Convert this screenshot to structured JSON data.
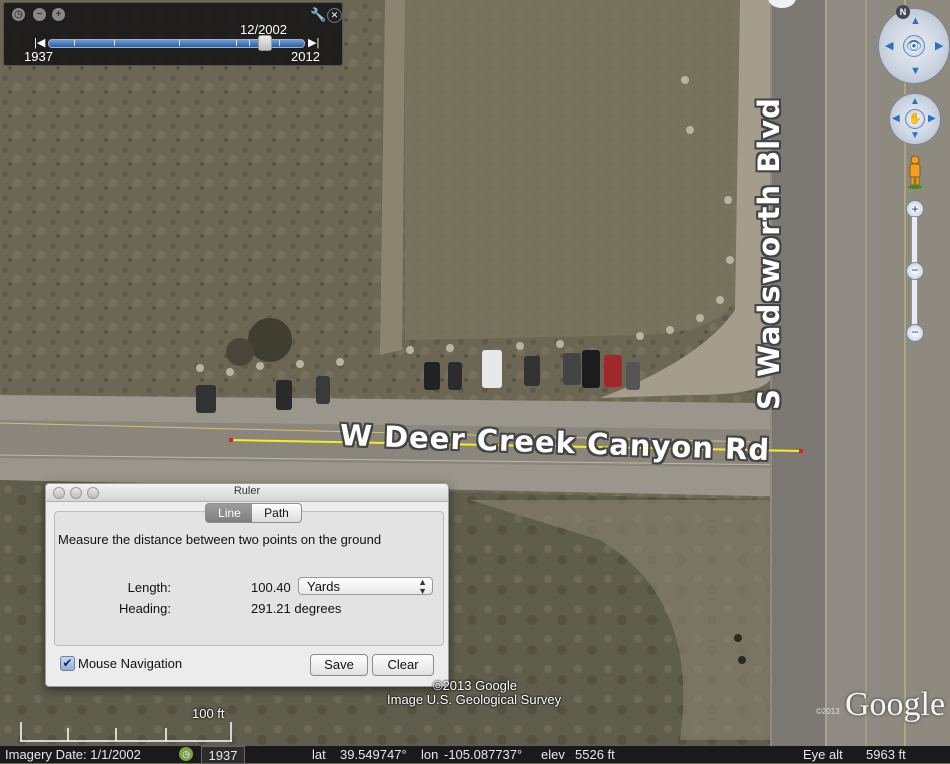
{
  "time_slider": {
    "current_date": "12/2002",
    "start_year": "1937",
    "end_year": "2012"
  },
  "map": {
    "road_label": "W Deer Creek Canyon Rd",
    "blvd_label": "S Wadsworth Blvd",
    "ruler_line_color": "#f5f019"
  },
  "ruler": {
    "title": "Ruler",
    "tabs": [
      {
        "label": "Line",
        "selected": true
      },
      {
        "label": "Path",
        "selected": false
      }
    ],
    "description": "Measure the distance between two points on the ground",
    "length_label": "Length:",
    "length_value": "100.40",
    "units": "Yards",
    "heading_label": "Heading:",
    "heading_value": "291.21 degrees",
    "mouse_navigation_label": "Mouse Navigation",
    "mouse_navigation_checked": true,
    "save_label": "Save",
    "clear_label": "Clear"
  },
  "attribution": {
    "copyright": "©2013 Google",
    "imagery_credit": "Image U.S. Geological Survey",
    "logo": "Google",
    "logo_copyright": "©2013"
  },
  "scale": {
    "label": "100 ft"
  },
  "compass": {
    "north": "N"
  },
  "statusbar": {
    "imagery_date": "Imagery Date: 1/1/2002",
    "history_year": "1937",
    "lat_label": "lat",
    "lat_value": "39.549747°",
    "lon_label": "lon",
    "lon_value": "-105.087737°",
    "elev_label": "elev",
    "elev_value": "5526 ft",
    "eye_alt_label": "Eye alt",
    "eye_alt_value": "5963 ft"
  }
}
